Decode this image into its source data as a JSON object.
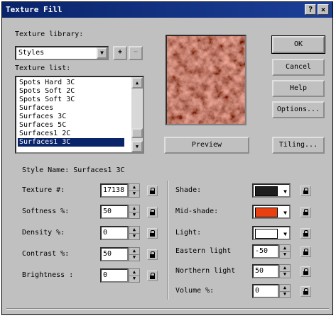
{
  "window": {
    "title": "Texture Fill",
    "help_btn": "?",
    "close_btn": "×"
  },
  "library": {
    "label": "Texture library:",
    "value": "Styles",
    "add_btn": "+",
    "remove_btn": "−"
  },
  "texture_list": {
    "label": "Texture list:",
    "items": [
      "Spots Hard 3C",
      "Spots Soft 2C",
      "Spots Soft 3C",
      "Surfaces",
      "Surfaces 3C",
      "Surfaces 5C",
      "Surfaces1 2C",
      "Surfaces1 3C"
    ],
    "selected": "Surfaces1 3C"
  },
  "buttons": {
    "ok": "OK",
    "cancel": "Cancel",
    "help": "Help",
    "options": "Options...",
    "preview": "Preview",
    "tiling": "Tiling..."
  },
  "style_name": "Style Name: Surfaces1 3C",
  "left_params": [
    {
      "label": "Texture #:",
      "value": "17138"
    },
    {
      "label": "Softness %:",
      "value": "50"
    },
    {
      "label": "Density %:",
      "value": "0"
    },
    {
      "label": "Contrast %:",
      "value": "50"
    },
    {
      "label": "Brightness   :",
      "value": "0"
    }
  ],
  "right_colors": [
    {
      "label": "Shade:",
      "color": "#1e1e1e"
    },
    {
      "label": "Mid-shade:",
      "color": "#e84010"
    },
    {
      "label": "Light:",
      "color": "#ffffff"
    }
  ],
  "right_params": [
    {
      "label": "Eastern light",
      "value": "-50"
    },
    {
      "label": "Northern light",
      "value": "50"
    },
    {
      "label": "Volume %:",
      "value": "0"
    }
  ]
}
